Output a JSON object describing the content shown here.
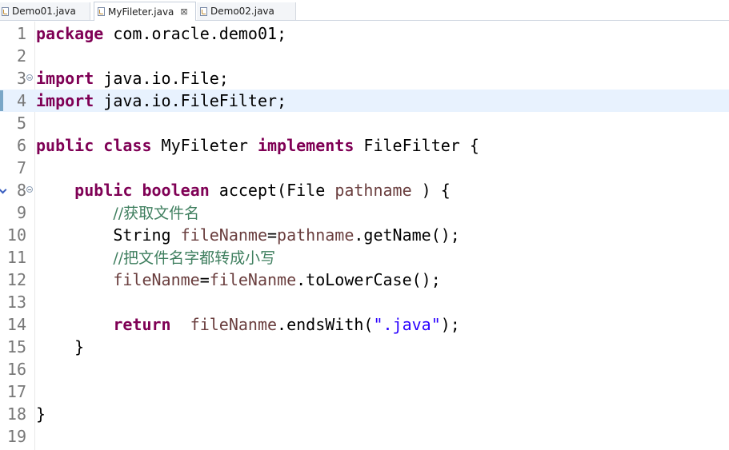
{
  "tabs": [
    {
      "label": "Demo01.java",
      "active": false
    },
    {
      "label": "MyFileter.java",
      "active": true,
      "close": "⊠"
    },
    {
      "label": "Demo02.java",
      "active": false
    }
  ],
  "editor": {
    "current_line": 4,
    "lines": [
      {
        "n": "1",
        "segs": [
          [
            "kw",
            "package"
          ],
          [
            "",
            "com.oracle.demo01;"
          ]
        ]
      },
      {
        "n": "2",
        "segs": []
      },
      {
        "n": "3",
        "fold": true,
        "segs": [
          [
            "kw",
            "import"
          ],
          [
            "",
            " java.io.File;"
          ]
        ]
      },
      {
        "n": "4",
        "segs": [
          [
            "kw",
            "import"
          ],
          [
            "",
            " java.io.FileFilter;"
          ]
        ]
      },
      {
        "n": "5",
        "segs": []
      },
      {
        "n": "6",
        "segs": [
          [
            "kw",
            "public"
          ],
          [
            "",
            " "
          ],
          [
            "kw",
            "class"
          ],
          [
            "",
            " MyFileter "
          ],
          [
            "kw",
            "implements"
          ],
          [
            "",
            " FileFilter {"
          ]
        ]
      },
      {
        "n": "7",
        "segs": []
      },
      {
        "n": "8",
        "fold": true,
        "override": true,
        "segs": [
          [
            "",
            "    "
          ],
          [
            "kw",
            "public"
          ],
          [
            "",
            " "
          ],
          [
            "kw",
            "boolean"
          ],
          [
            "",
            " accept(File "
          ],
          [
            "fld",
            "pathname"
          ],
          [
            "",
            " ) {"
          ]
        ]
      },
      {
        "n": "9",
        "segs": [
          [
            "",
            "        "
          ],
          [
            "cm",
            "//获取文件名"
          ]
        ]
      },
      {
        "n": "10",
        "segs": [
          [
            "",
            "        String "
          ],
          [
            "fld",
            "fileNanme"
          ],
          [
            "",
            "="
          ],
          [
            "fld",
            "pathname"
          ],
          [
            "",
            ".getName();"
          ]
        ]
      },
      {
        "n": "11",
        "segs": [
          [
            "",
            "        "
          ],
          [
            "cm",
            "//把文件名字都转成小写"
          ]
        ]
      },
      {
        "n": "12",
        "segs": [
          [
            "",
            "        "
          ],
          [
            "fld",
            "fileNanme"
          ],
          [
            "",
            "="
          ],
          [
            "fld",
            "fileNanme"
          ],
          [
            "",
            ".toLowerCase();"
          ]
        ]
      },
      {
        "n": "13",
        "segs": []
      },
      {
        "n": "14",
        "segs": [
          [
            "",
            "        "
          ],
          [
            "kw",
            "return"
          ],
          [
            "",
            "  "
          ],
          [
            "fld",
            "fileNanme"
          ],
          [
            "",
            ".endsWith("
          ],
          [
            "str",
            "\".java\""
          ],
          [
            "",
            ");"
          ]
        ]
      },
      {
        "n": "15",
        "segs": [
          [
            "",
            "    }"
          ]
        ]
      },
      {
        "n": "16",
        "segs": []
      },
      {
        "n": "17",
        "segs": []
      },
      {
        "n": "18",
        "segs": [
          [
            "",
            "}"
          ]
        ]
      },
      {
        "n": "19",
        "segs": []
      }
    ]
  },
  "colors": {
    "keyword": "#7f0055",
    "comment": "#3f7f5f",
    "field": "#6a3e3e",
    "string": "#2a00ff",
    "current_line": "#e8f2fe"
  }
}
